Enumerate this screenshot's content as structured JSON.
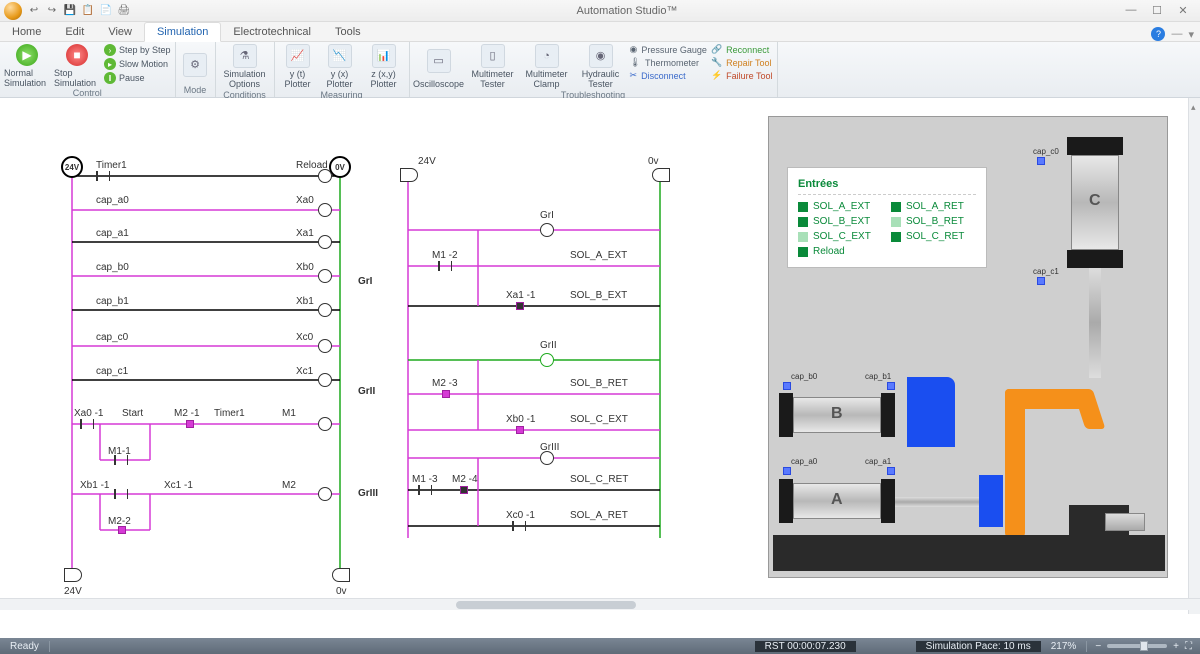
{
  "app": {
    "title": "Automation Studio™"
  },
  "window_controls": {
    "min": "—",
    "max": "☐",
    "close": "✕"
  },
  "qat": [
    "↩",
    "↪",
    "💾",
    "📋",
    "📄",
    "🖨"
  ],
  "tabs": {
    "items": [
      "Home",
      "Edit",
      "View",
      "Simulation",
      "Electrotechnical",
      "Tools"
    ],
    "active_index": 3
  },
  "ribbon": {
    "groups": {
      "control": {
        "label": "Control",
        "normal": "Normal Simulation",
        "stop": "Stop Simulation",
        "step_by_step": "Step by Step",
        "slow_motion": "Slow Motion",
        "pause": "Pause"
      },
      "mode": {
        "label": "Mode"
      },
      "conditions": {
        "label": "Conditions",
        "sim_options": "Simulation Options"
      },
      "measuring": {
        "label": "Measuring",
        "yt": "y (t) Plotter",
        "yx": "y (x) Plotter",
        "zxy": "z (x,y) Plotter"
      },
      "troubleshooting": {
        "label": "Troubleshooting",
        "oscilloscope": "Oscilloscope",
        "multimeter": "Multimeter Tester",
        "clamp": "Multimeter Clamp",
        "hydraulic": "Hydraulic Tester",
        "pressure": "Pressure Gauge",
        "thermo": "Thermometer",
        "disconnect": "Disconnect",
        "reconnect": "Reconnect",
        "repair": "Repair Tool",
        "failure": "Failure Tool"
      }
    }
  },
  "ladder_left": {
    "v24": "24V",
    "v0": "0V",
    "timer": "Timer1",
    "reload": "Reload",
    "rows": [
      {
        "l": "cap_a0",
        "r": "Xa0"
      },
      {
        "l": "cap_a1",
        "r": "Xa1"
      },
      {
        "l": "cap_b0",
        "r": "Xb0"
      },
      {
        "l": "cap_b1",
        "r": "Xb1"
      },
      {
        "l": "cap_c0",
        "r": "Xc0"
      },
      {
        "l": "cap_c1",
        "r": "Xc1"
      }
    ],
    "xa0_1": "Xa0 -1",
    "start": "Start",
    "m2_1": "M2 -1",
    "timer2": "Timer1",
    "m1": "M1",
    "m1_1": "M1-1",
    "xb1_1": "Xb1 -1",
    "xc1_1": "Xc1 -1",
    "m2": "M2",
    "m2_2": "M2-2",
    "bot24": "24V",
    "bot0": "0v"
  },
  "ladder_right": {
    "v24": "24V",
    "v0": "0v",
    "gr1": "GrI",
    "gr2": "GrII",
    "gr3": "GrIII",
    "gr1_lbl": "GrI",
    "gr2_lbl": "GrII",
    "gr3_lbl": "GrIII",
    "m1_2": "M1 -2",
    "sol_a_ext": "SOL_A_EXT",
    "xa1_1": "Xa1 -1",
    "sol_b_ext": "SOL_B_EXT",
    "m2_3": "M2 -3",
    "sol_b_ret": "SOL_B_RET",
    "xb0_1": "Xb0 -1",
    "sol_c_ext": "SOL_C_EXT",
    "m1_3": "M1 -3",
    "m2_4": "M2 -4",
    "sol_c_ret": "SOL_C_RET",
    "xc0_1": "Xc0 -1",
    "sol_a_ret": "SOL_A_RET"
  },
  "legend": {
    "title": "Entrées",
    "items": [
      {
        "t": "SOL_A_EXT",
        "on": true
      },
      {
        "t": "SOL_A_RET",
        "on": true
      },
      {
        "t": "SOL_B_EXT",
        "on": true
      },
      {
        "t": "SOL_B_RET",
        "on": false
      },
      {
        "t": "SOL_C_EXT",
        "on": false
      },
      {
        "t": "SOL_C_RET",
        "on": true
      },
      {
        "t": "Reload",
        "on": true
      }
    ]
  },
  "caps": {
    "c0": "cap_c0",
    "c1": "cap_c1",
    "b0": "cap_b0",
    "b1": "cap_b1",
    "a0": "cap_a0",
    "a1": "cap_a1"
  },
  "cylinders": {
    "a": "A",
    "b": "B",
    "c": "C"
  },
  "status": {
    "ready": "Ready",
    "rst": "RST 00:00:07.230",
    "pace": "Simulation Pace: 10 ms",
    "zoom": "217%"
  }
}
